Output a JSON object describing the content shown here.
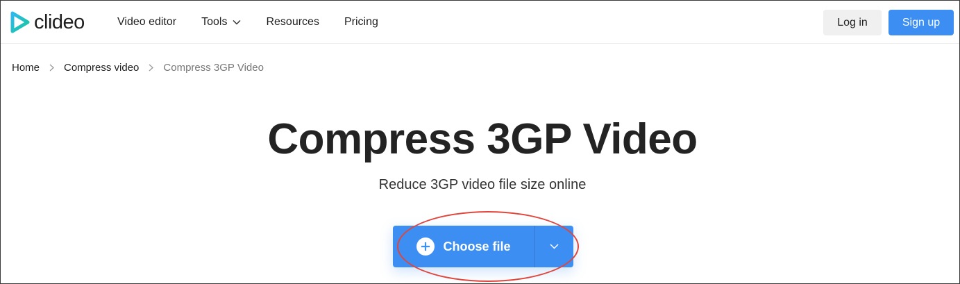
{
  "brand": {
    "name": "clideo",
    "logo_icon": "play-triangle-icon",
    "colors": {
      "teal": "#21c3b4",
      "blue": "#3c8ef3"
    }
  },
  "nav": {
    "items": [
      {
        "label": "Video editor"
      },
      {
        "label": "Tools",
        "icon": "chevron-down-icon"
      },
      {
        "label": "Resources"
      },
      {
        "label": "Pricing"
      }
    ]
  },
  "auth": {
    "login_label": "Log in",
    "signup_label": "Sign up"
  },
  "breadcrumb": {
    "items": [
      {
        "label": "Home"
      },
      {
        "label": "Compress video"
      },
      {
        "label": "Compress 3GP Video"
      }
    ]
  },
  "main": {
    "title": "Compress 3GP Video",
    "subtitle": "Reduce 3GP video file size online",
    "upload": {
      "choose_label": "Choose file",
      "plus_icon": "plus-circle-icon",
      "dropdown_icon": "chevron-down-icon"
    }
  },
  "colors": {
    "accent": "#3c8ef3",
    "annotation": "#e0463c",
    "text": "#232323"
  }
}
